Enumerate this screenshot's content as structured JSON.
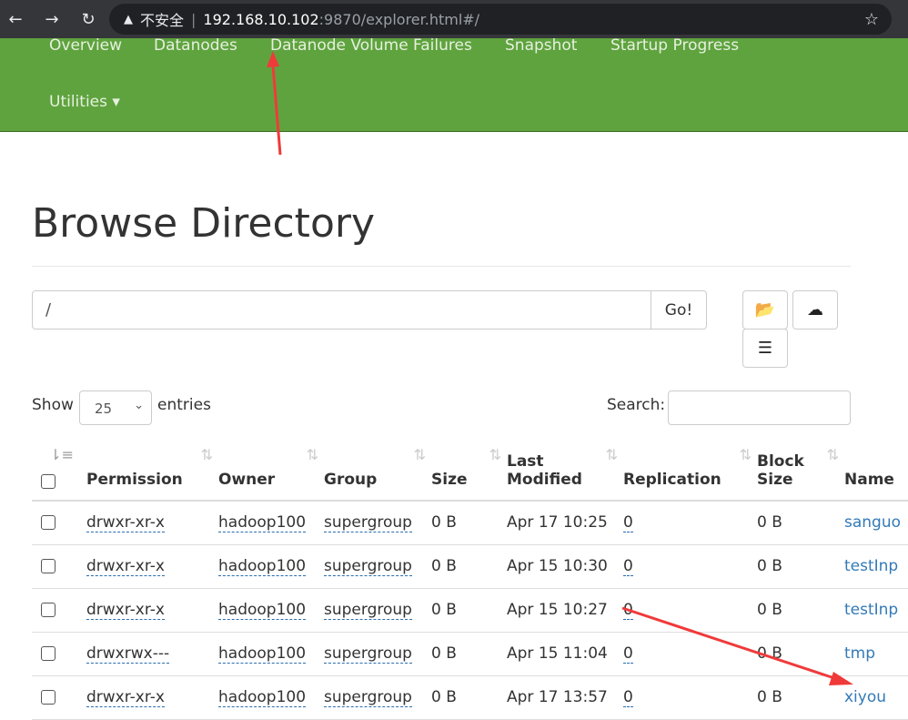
{
  "browser": {
    "warning": "不安全",
    "host": "192.168.10.102",
    "path": ":9870/explorer.html#/"
  },
  "navbar": {
    "items": [
      "Overview",
      "Datanodes",
      "Datanode Volume Failures",
      "Snapshot",
      "Startup Progress"
    ],
    "utilities": "Utilities ▾"
  },
  "page": {
    "title": "Browse Directory",
    "path_value": "/",
    "go_label": "Go!"
  },
  "controls": {
    "show_label": "Show",
    "entries_value": "25",
    "entries_label": "entries",
    "search_label": "Search:",
    "search_value": ""
  },
  "table": {
    "headers": [
      "Permission",
      "Owner",
      "Group",
      "Size",
      "Last Modified",
      "Replication",
      "Block Size",
      "Name"
    ],
    "rows": [
      {
        "perm": "drwxr-xr-x",
        "owner": "hadoop100",
        "group": "supergroup",
        "size": "0 B",
        "modified": "Apr 17 10:25",
        "repl": "0",
        "block": "0 B",
        "name": "sanguo"
      },
      {
        "perm": "drwxr-xr-x",
        "owner": "hadoop100",
        "group": "supergroup",
        "size": "0 B",
        "modified": "Apr 15 10:30",
        "repl": "0",
        "block": "0 B",
        "name": "testInp"
      },
      {
        "perm": "drwxr-xr-x",
        "owner": "hadoop100",
        "group": "supergroup",
        "size": "0 B",
        "modified": "Apr 15 10:27",
        "repl": "0",
        "block": "0 B",
        "name": "testInp"
      },
      {
        "perm": "drwxrwx---",
        "owner": "hadoop100",
        "group": "supergroup",
        "size": "0 B",
        "modified": "Apr 15 11:04",
        "repl": "0",
        "block": "0 B",
        "name": "tmp"
      },
      {
        "perm": "drwxr-xr-x",
        "owner": "hadoop100",
        "group": "supergroup",
        "size": "0 B",
        "modified": "Apr 17 13:57",
        "repl": "0",
        "block": "0 B",
        "name": "xiyou"
      }
    ]
  },
  "colors": {
    "navbar": "#5fa33e",
    "link": "#337ab7",
    "annotation": "#f03a3a"
  }
}
